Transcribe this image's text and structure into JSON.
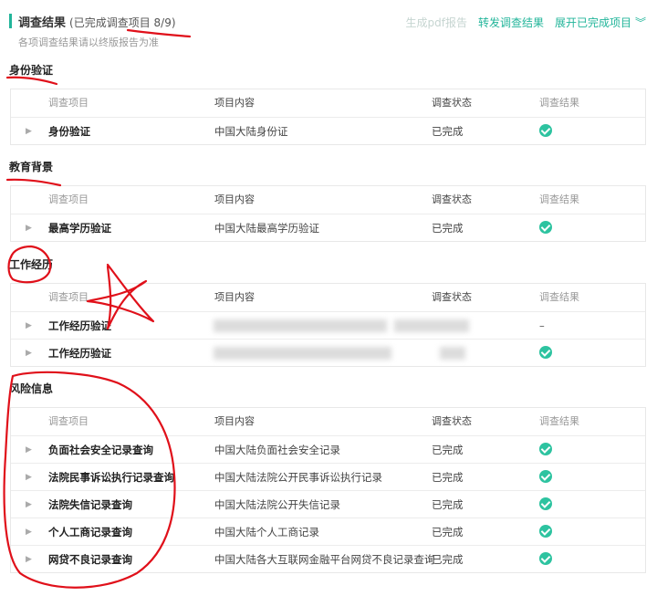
{
  "header": {
    "title": "调查结果",
    "subtitle": "(已完成调查项目 8/9)",
    "note": "各项调查结果请以终版报告为准",
    "actions": {
      "generate_pdf": "生成pdf报告",
      "forward": "转发调查结果",
      "expand": "展开已完成项目"
    }
  },
  "columns": {
    "item": "调查项目",
    "content": "项目内容",
    "status": "调查状态",
    "result": "调查结果"
  },
  "sections": [
    {
      "title": "身份验证",
      "rows": [
        {
          "item": "身份验证",
          "content": "中国大陆身份证",
          "status": "已完成",
          "result": "check"
        }
      ]
    },
    {
      "title": "教育背景",
      "rows": [
        {
          "item": "最高学历验证",
          "content": "中国大陆最高学历验证",
          "status": "已完成",
          "result": "check"
        }
      ]
    },
    {
      "title": "工作经历",
      "rows": [
        {
          "item": "工作经历验证",
          "content": "",
          "status": "",
          "result": "–"
        },
        {
          "item": "工作经历验证",
          "content": "",
          "status": "",
          "result": "check"
        }
      ]
    },
    {
      "title": "风险信息",
      "rows": [
        {
          "item": "负面社会安全记录查询",
          "content": "中国大陆负面社会安全记录",
          "status": "已完成",
          "result": "check"
        },
        {
          "item": "法院民事诉讼执行记录查询",
          "content": "中国大陆法院公开民事诉讼执行记录",
          "status": "已完成",
          "result": "check"
        },
        {
          "item": "法院失信记录查询",
          "content": "中国大陆法院公开失信记录",
          "status": "已完成",
          "result": "check"
        },
        {
          "item": "个人工商记录查询",
          "content": "中国大陆个人工商记录",
          "status": "已完成",
          "result": "check"
        },
        {
          "item": "网贷不良记录查询",
          "content": "中国大陆各大互联网金融平台网贷不良记录查询",
          "status": "已完成",
          "result": "check"
        }
      ]
    }
  ],
  "colors": {
    "accent": "#22b59a",
    "check": "#2dc3a0",
    "annotation": "#e0101a"
  }
}
